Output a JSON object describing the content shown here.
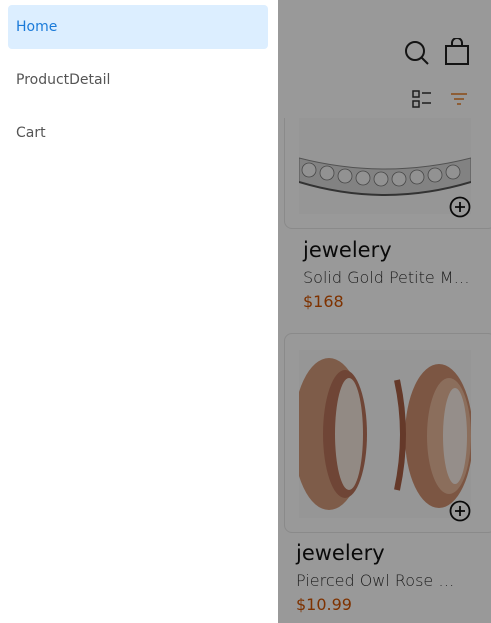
{
  "drawer": {
    "items": [
      {
        "label": "Home",
        "active": true
      },
      {
        "label": "ProductDetail",
        "active": false
      },
      {
        "label": "Cart",
        "active": false
      }
    ]
  },
  "toolbar": {
    "icons": [
      "search-icon",
      "shopping-bag-icon",
      "list-view-icon",
      "filter-icon"
    ]
  },
  "products": [
    {
      "category": "jewelery",
      "name": "Solid Gold Petite Micropave",
      "price": "$168"
    },
    {
      "category": "jewelery",
      "name": "Pierced Owl Rose Gold Plated",
      "price": "$10.99"
    }
  ],
  "colors": {
    "accent": "#1a7ad9",
    "active_bg": "#dceeff",
    "price": "#d35400",
    "overlay": "rgba(0,0,0,0.4)"
  }
}
